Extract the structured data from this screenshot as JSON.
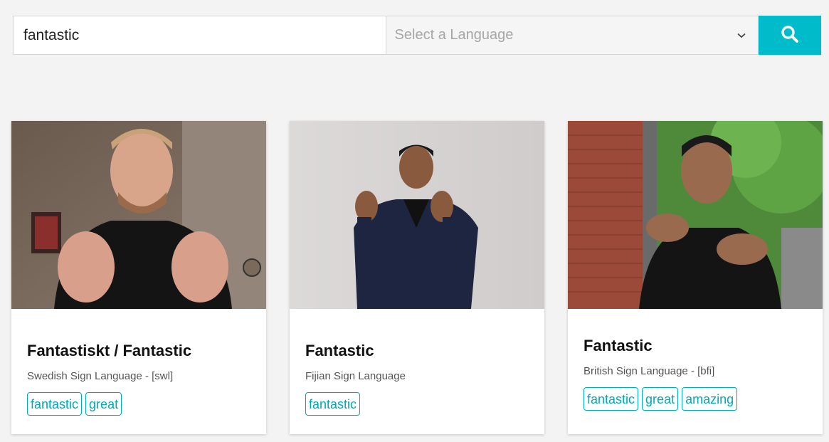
{
  "search": {
    "query": "fantastic",
    "language_placeholder": "Select a Language",
    "search_icon": "search-icon",
    "chevron_icon": "chevron-down-icon"
  },
  "colors": {
    "accent": "#00bcca",
    "tag": "#00a9b7",
    "background": "#f3f3f3"
  },
  "results": [
    {
      "title": "Fantastiskt / Fantastic",
      "language": "Swedish Sign Language - [swl]",
      "tags": [
        "fantastic",
        "great"
      ]
    },
    {
      "title": "Fantastic",
      "language": "Fijian Sign Language",
      "tags": [
        "fantastic"
      ]
    },
    {
      "title": "Fantastic",
      "language": "British Sign Language - [bfi]",
      "tags": [
        "fantastic",
        "great",
        "amazing"
      ]
    }
  ]
}
